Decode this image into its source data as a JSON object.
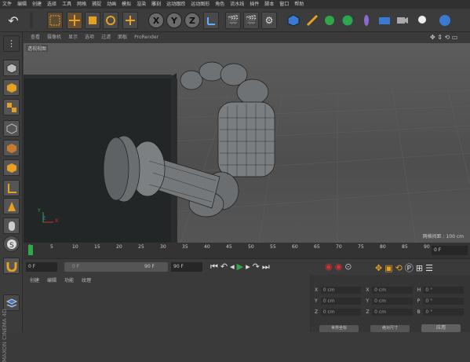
{
  "menu": [
    "文件",
    "编辑",
    "创建",
    "选择",
    "工具",
    "网格",
    "捕捉",
    "动画",
    "模拟",
    "渲染",
    "雕刻",
    "运动跟踪",
    "运动图形",
    "角色",
    "流水线",
    "插件",
    "脚本",
    "窗口",
    "帮助"
  ],
  "toolbar": {
    "axes": [
      "X",
      "Y",
      "Z"
    ]
  },
  "viewport_menu": [
    "查看",
    "摄像机",
    "显示",
    "选项",
    "过滤",
    "面板",
    "ProRender"
  ],
  "viewport": {
    "label": "透视视图",
    "grid_info": "网格间距 : 100 cm",
    "axis_labels": [
      "Y",
      "Z",
      "X"
    ]
  },
  "timeline": {
    "ticks": [
      "0",
      "5",
      "10",
      "15",
      "20",
      "25",
      "30",
      "35",
      "40",
      "45",
      "50",
      "55",
      "60",
      "65",
      "70",
      "75",
      "80",
      "85",
      "90"
    ],
    "current_frame": "0 F"
  },
  "transport": {
    "start_field": "0 F",
    "mini_field": "0 F",
    "end_a": "90 F",
    "end_b": "90 F"
  },
  "object_manager": {
    "tabs": [
      "创建",
      "编辑",
      "功能",
      "纹理"
    ]
  },
  "coords": {
    "rows": [
      {
        "a": "X",
        "va": "0 cm",
        "b": "X",
        "vb": "0 cm",
        "c": "H",
        "vc": "0 °"
      },
      {
        "a": "Y",
        "va": "0 cm",
        "b": "Y",
        "vb": "0 cm",
        "c": "P",
        "vc": "0 °"
      },
      {
        "a": "Z",
        "va": "0 cm",
        "b": "Z",
        "vb": "0 cm",
        "c": "B",
        "vc": "0 °"
      }
    ],
    "mode_a": "世界坐标",
    "mode_b": "绝对尺寸",
    "apply": "应用"
  },
  "brand": "MAXON CINEMA 4D",
  "colors": {
    "accent": "#e8a020",
    "play": "#2fa84a",
    "record": "#d03030",
    "blue": "#3a7ad0"
  }
}
